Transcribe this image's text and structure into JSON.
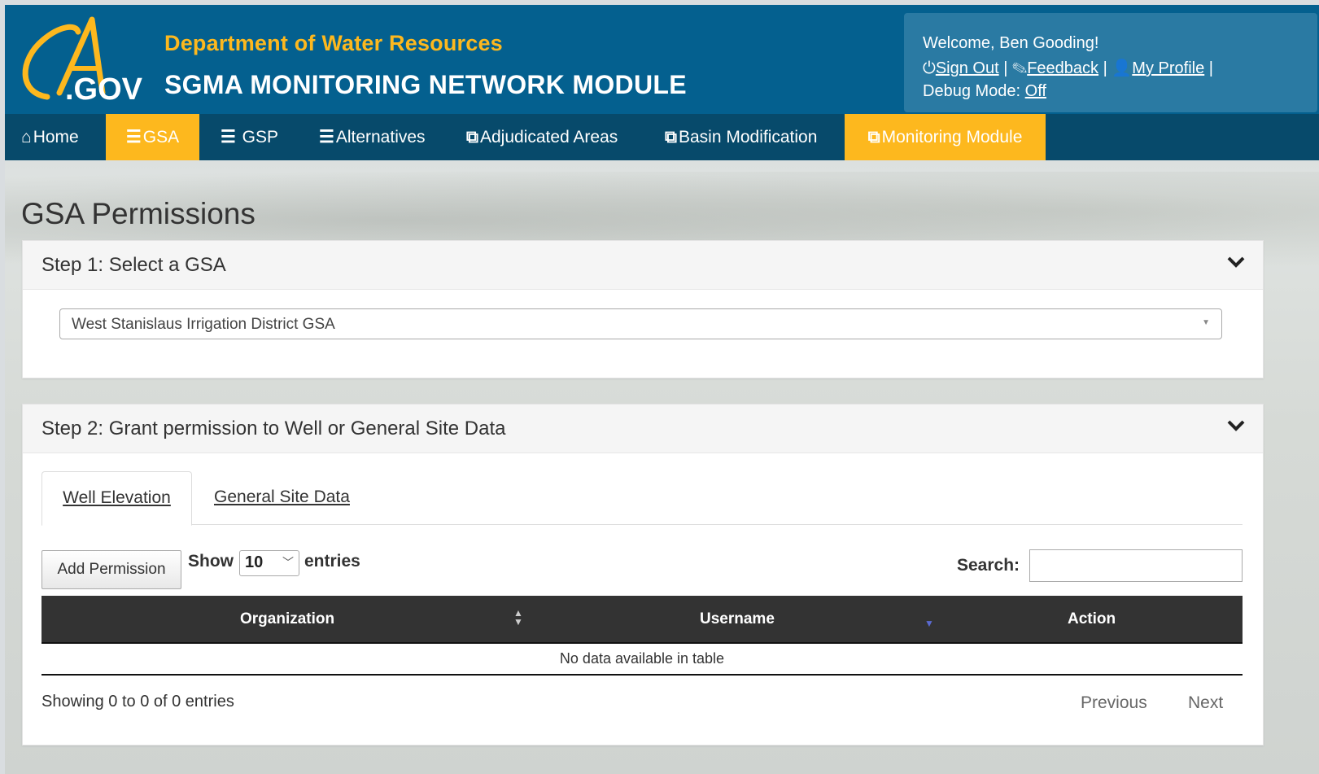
{
  "header": {
    "department": "Department of Water Resources",
    "app_title": "SGMA MONITORING NETWORK MODULE",
    "logo_text": "CA.GOV"
  },
  "user": {
    "welcome": "Welcome, Ben Gooding!",
    "sign_out": "Sign Out",
    "feedback": "Feedback",
    "profile": "My Profile",
    "debug_label": "Debug Mode:",
    "debug_value": "Off"
  },
  "nav": {
    "items": [
      {
        "label": "Home",
        "icon": "home-icon"
      },
      {
        "label": "GSA",
        "icon": "menu-icon",
        "active": true
      },
      {
        "label": " GSP",
        "icon": "menu-icon"
      },
      {
        "label": "Alternatives",
        "icon": "menu-icon"
      },
      {
        "label": "Adjudicated Areas",
        "icon": "external-link-icon"
      },
      {
        "label": "Basin Modification",
        "icon": "external-link-icon"
      },
      {
        "label": "Monitoring Module",
        "icon": "external-link-icon",
        "active": true
      }
    ]
  },
  "page": {
    "title": "GSA Permissions"
  },
  "step1": {
    "title": "Step 1: Select a GSA",
    "selected": "West Stanislaus Irrigation District GSA"
  },
  "step2": {
    "title": "Step 2: Grant permission to Well or General Site Data",
    "tabs": [
      "Well Elevation",
      "General Site Data"
    ],
    "add_button": "Add Permission",
    "show_label": "Show",
    "page_length": "10",
    "entries_label": "entries",
    "search_label": "Search:",
    "search_value": "",
    "columns": [
      "Organization",
      "Username",
      "Action"
    ],
    "empty_message": "No data available in table",
    "info": "Showing 0 to 0 of 0 entries",
    "previous": "Previous",
    "next": "Next"
  },
  "colors": {
    "header_blue": "#04608f",
    "nav_blue": "#074a6b",
    "accent_gold": "#fdb81e"
  }
}
